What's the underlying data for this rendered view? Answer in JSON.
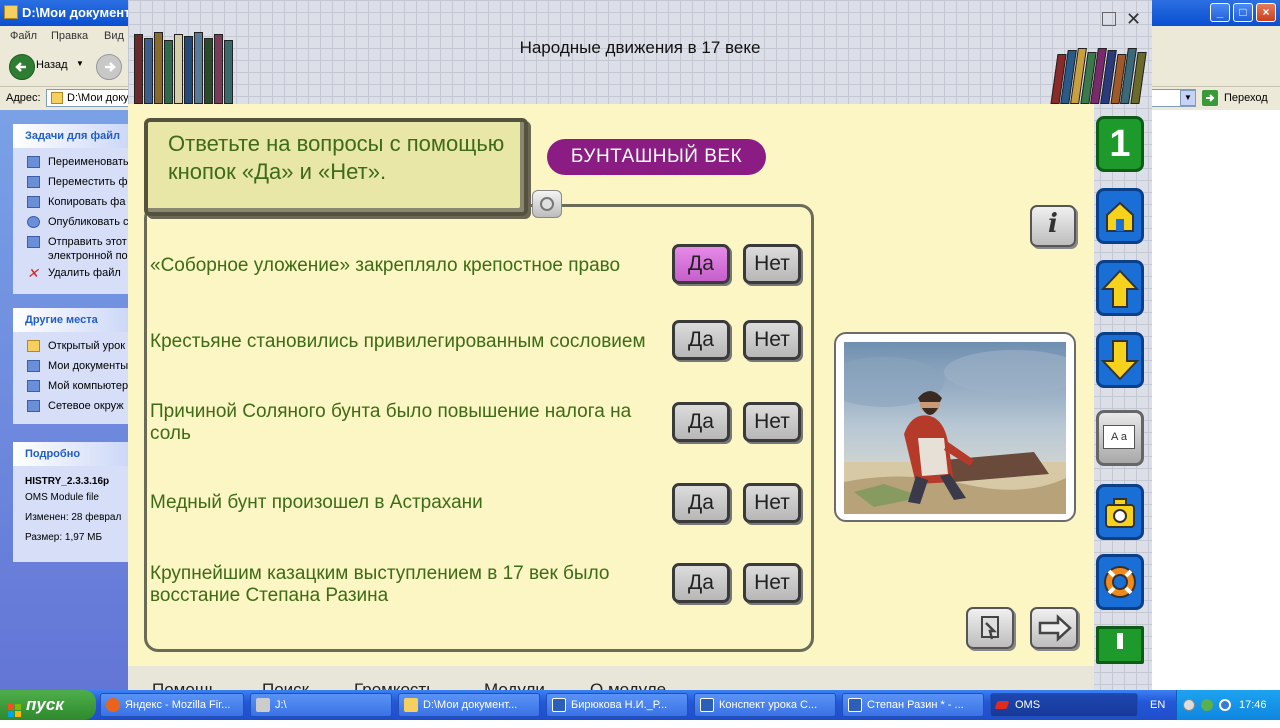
{
  "explorer": {
    "title": "D:\\Мои документ",
    "menu": [
      "Файл",
      "Правка",
      "Вид"
    ],
    "back_label": "Назад",
    "address_label": "Адрес:",
    "address_value": "D:\\Мои доку",
    "go_label": "Переход",
    "tasks_header": "Задачи для файл",
    "tasks": [
      "Переименовать",
      "Переместить фа",
      "Копировать фа",
      "Опубликовать с",
      "Отправить этот",
      "электронной по",
      "Удалить файл"
    ],
    "places_header": "Другие места",
    "places": [
      "Открытый урок",
      "Мои документы",
      "Мой компьютер",
      "Сетевое окруж"
    ],
    "details_header": "Подробно",
    "details": {
      "name": "HISTRY_2.3.3.16p",
      "type": "OMS Module file",
      "modified": "Изменен: 28 феврал",
      "size": "Размер: 1,97 МБ"
    }
  },
  "lesson": {
    "title": "Народные движения в 17 веке",
    "close_glyph": "✕",
    "instruction": "Ответьте на вопросы с помощью кнопок «Да» и «Нет».",
    "topic_badge": "БУНТАШНЫЙ ВЕК",
    "yes_label": "Да",
    "no_label": "Нет",
    "questions": [
      {
        "text": "«Соборное уложение» закрепляло крепостное право",
        "selected": "yes"
      },
      {
        "text": "Крестьяне становились привилегированным сословием",
        "selected": null
      },
      {
        "text": "Причиной Соляного бунта было повышение налога на соль",
        "selected": null
      },
      {
        "text": "Медный бунт произошел в Астрахани",
        "selected": null
      },
      {
        "text": "Крупнейшим казацким выступлением в 17 век было восстание Степана Разина",
        "selected": null
      }
    ],
    "info_glyph": "i",
    "side_number": "1",
    "dictionary_glyph": "A a",
    "bottom_menu": [
      "Помощь",
      "Поиск",
      "Громкость",
      "Модули",
      "О модуле"
    ]
  },
  "taskbar": {
    "start_label": "пуск",
    "items": [
      "Яндекс - Mozilla Fir...",
      "J:\\",
      "D:\\Мои документ...",
      "Бирюкова Н.И._Р...",
      "Конспект урока С...",
      "Степан Разин * - ...",
      "OMS"
    ],
    "language": "EN",
    "clock": "17:46"
  },
  "colors": {
    "panel_bg": "#fbf6c3",
    "text_green": "#3d6b17",
    "badge_purple": "#8a1c83",
    "selected_yes": "#d977dc"
  }
}
